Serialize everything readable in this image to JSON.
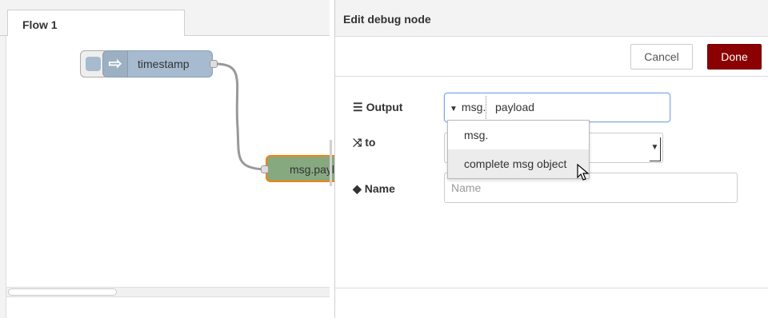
{
  "workspace": {
    "tab_label": "Flow 1",
    "nodes": {
      "inject_label": "timestamp",
      "debug_label": "msg.payload"
    }
  },
  "editor": {
    "title": "Edit debug node",
    "cancel_label": "Cancel",
    "done_label": "Done",
    "output": {
      "label": "Output",
      "type_prefix": "msg.",
      "value": "payload"
    },
    "to": {
      "label": "to"
    },
    "name": {
      "label": "Name",
      "placeholder": "Name",
      "value": ""
    },
    "dropdown": {
      "options": [
        "msg.",
        "complete msg object"
      ],
      "hovered_index": 1
    }
  },
  "colors": {
    "inject_node": "#a6bbcf",
    "debug_node": "#87a980",
    "selected_outline": "#ff7f0e",
    "done_button": "#8b0000"
  },
  "icons": {
    "inject": "arrow-right-icon",
    "output": "list-icon",
    "to": "shuffle-icon",
    "name": "tag-icon"
  }
}
